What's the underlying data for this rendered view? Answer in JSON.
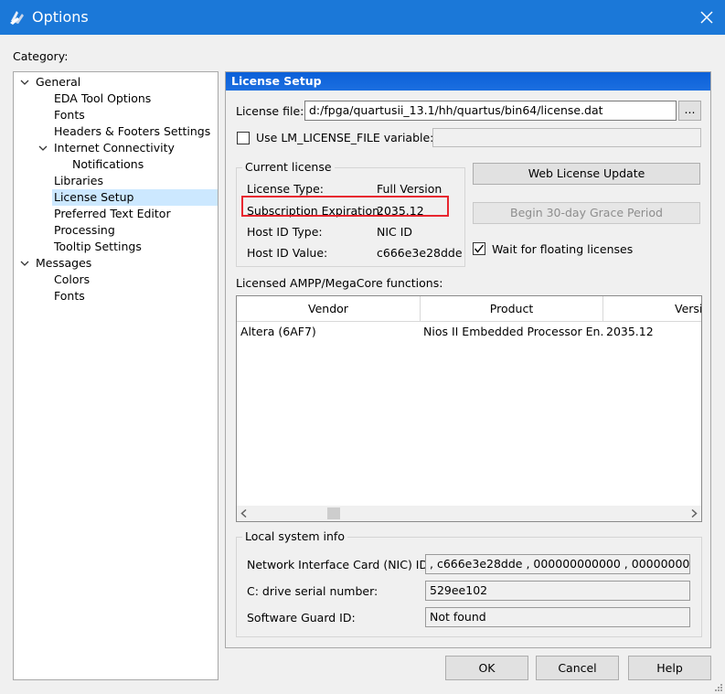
{
  "window": {
    "title": "Options",
    "close_icon": "close-icon",
    "app_icon": "quartus-icon"
  },
  "category": {
    "label": "Category:",
    "items": [
      {
        "label": "General",
        "level": 0,
        "expanded": true
      },
      {
        "label": "EDA Tool Options",
        "level": 1
      },
      {
        "label": "Fonts",
        "level": 1
      },
      {
        "label": "Headers & Footers Settings",
        "level": 1
      },
      {
        "label": "Internet Connectivity",
        "level": 1,
        "expanded": true
      },
      {
        "label": "Notifications",
        "level": 2
      },
      {
        "label": "Libraries",
        "level": 1
      },
      {
        "label": "License Setup",
        "level": 1,
        "selected": true
      },
      {
        "label": "Preferred Text Editor",
        "level": 1
      },
      {
        "label": "Processing",
        "level": 1
      },
      {
        "label": "Tooltip Settings",
        "level": 1
      },
      {
        "label": "Messages",
        "level": 0,
        "expanded": true
      },
      {
        "label": "Colors",
        "level": 1
      },
      {
        "label": "Fonts",
        "level": 1
      }
    ]
  },
  "panel": {
    "header": "License Setup",
    "license_file_label": "License file:",
    "license_file_value": "d:/fpga/quartusii_13.1/hh/quartus/bin64/license.dat",
    "browse_label": "...",
    "use_lm_label": "Use LM_LICENSE_FILE variable:",
    "use_lm_checked": false,
    "lm_value": "",
    "current_license": {
      "title": "Current license",
      "type_label": "License Type:",
      "type_value": "Full Version",
      "expiration_label": "Subscription Expiration:",
      "expiration_value": "2035.12",
      "hostid_type_label": "Host ID Type:",
      "hostid_type_value": "NIC ID",
      "hostid_value_label": "Host ID Value:",
      "hostid_value_value": "c666e3e28dde"
    },
    "web_license_update_label": "Web License Update",
    "grace_period_label": "Begin 30-day Grace Period",
    "wait_floating_label": "Wait for floating licenses",
    "wait_floating_checked": true,
    "functions_label": "Licensed AMPP/MegaCore functions:",
    "table": {
      "headers": [
        "Vendor",
        "Product",
        "Versi"
      ],
      "rows": [
        [
          "Altera (6AF7)",
          "Nios II Embedded Processor En...",
          "2035.12"
        ]
      ]
    },
    "local_info": {
      "title": "Local system info",
      "nic_label": "Network Interface Card (NIC) ID:",
      "nic_value": ", c666e3e28dde , 000000000000 , 000000000000",
      "drive_label": "C: drive serial number:",
      "drive_value": "529ee102",
      "guard_label": "Software Guard ID:",
      "guard_value": "Not found"
    }
  },
  "buttons": {
    "ok": "OK",
    "cancel": "Cancel",
    "help": "Help"
  },
  "colors": {
    "titlebar": "#1b78d8",
    "panel_header": "#1565dc",
    "highlight": "#e8262f",
    "selection": "#cce8ff"
  }
}
